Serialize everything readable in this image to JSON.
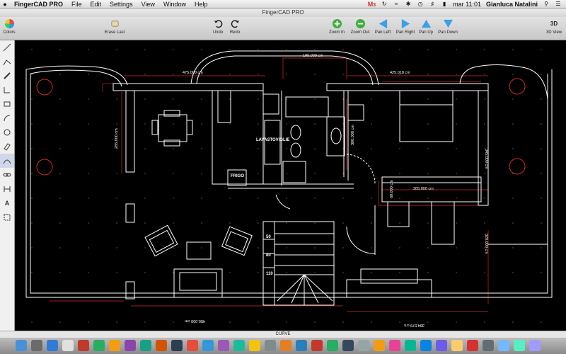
{
  "menubar": {
    "app_name": "FingerCAD PRO",
    "items": [
      "File",
      "Edit",
      "Settings",
      "View",
      "Window",
      "Help"
    ],
    "mail_count": "3",
    "clock": "mar 11:01",
    "user": "Gianluca Natalini"
  },
  "window": {
    "title": "FingerCAD PRO"
  },
  "toolbar": {
    "colors": "Colors",
    "erase_last": "Erase Last",
    "undo": "Undo",
    "redo": "Redo",
    "zoom_in": "Zoom In",
    "zoom_out": "Zoom Out",
    "pan_left": "Pan Left",
    "pan_right": "Pan Right",
    "pan_up": "Pan Up",
    "pan_down": "Pan Down",
    "view_3d": "3D View",
    "view_3d_badge": "3D"
  },
  "tools": [
    "line-tool",
    "polyline-tool",
    "pen-tool",
    "angle-tool",
    "rectangle-tool",
    "arc-tool",
    "circle-tool",
    "eraser-tool",
    "curve-tool",
    "link-tool",
    "dimension-tool",
    "text-tool",
    "select-tool"
  ],
  "drawing": {
    "dims": {
      "d1": "475.000 cm",
      "d2": "195.000 cm",
      "d3": "425.018 cm",
      "d4": "285.000 cm",
      "d5": "300.008 cm",
      "d6": "345.000 cm",
      "d7": "305.000 cm",
      "d8": "60.000 cm",
      "d9": "320.000 cm",
      "d10": "450.000 cm",
      "d11": "384.579 cm"
    },
    "labels": {
      "dishwasher": "LAVASTOVIGLIE",
      "fridge": "FRIGO",
      "step1": "50",
      "step2": "80",
      "step3": "110"
    }
  },
  "status": {
    "mode": "CURVE"
  },
  "colors": {
    "canvas": "#000000",
    "walls": "#ffffff",
    "dim_lines": "#d42a2a",
    "accent": "#3aa0e8"
  }
}
